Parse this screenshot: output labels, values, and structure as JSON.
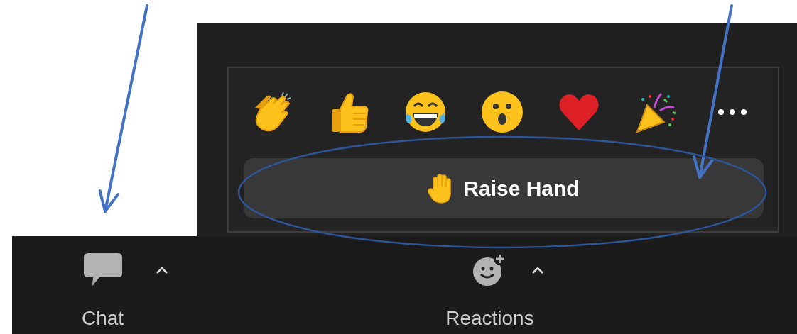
{
  "reactions_panel": {
    "reactions": [
      {
        "kind": "clap"
      },
      {
        "kind": "thumbs-up"
      },
      {
        "kind": "laugh-tears"
      },
      {
        "kind": "surprised"
      },
      {
        "kind": "heart"
      },
      {
        "kind": "party-popper"
      },
      {
        "kind": "more"
      }
    ],
    "raise_hand_button": {
      "label": "Raise Hand"
    }
  },
  "toolbar": [
    {
      "kind": "chat",
      "label": "Chat"
    },
    {
      "kind": "reactions",
      "label": "Reactions"
    }
  ],
  "annotations": [
    {
      "kind": "arrow"
    },
    {
      "kind": "arrow"
    },
    {
      "kind": "ellipse"
    }
  ]
}
